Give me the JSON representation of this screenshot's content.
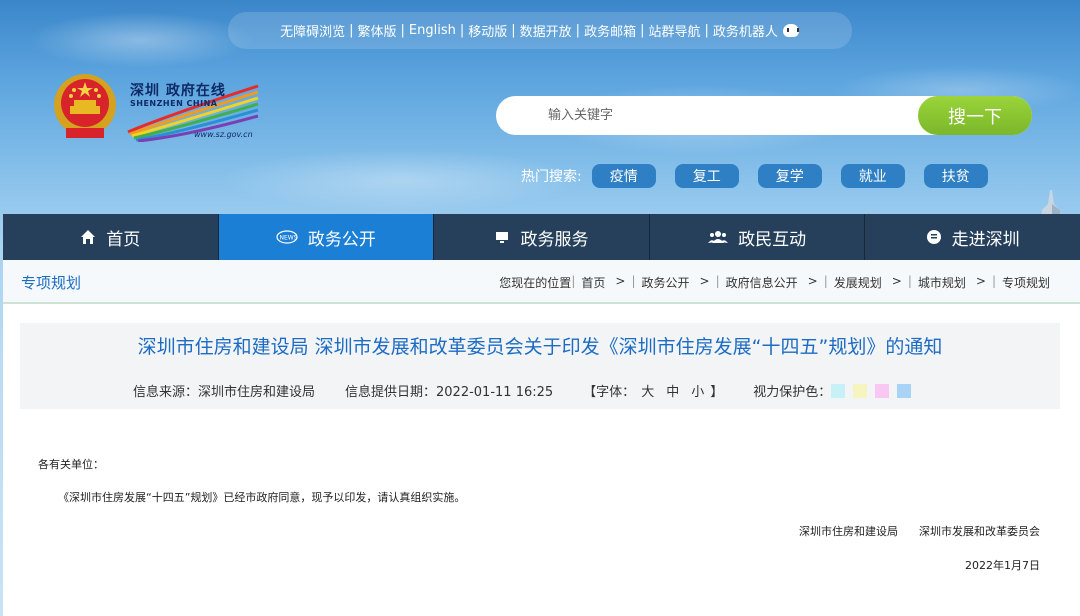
{
  "topbar": {
    "links": [
      "无障碍浏览",
      "繁体版",
      "English",
      "移动版",
      "数据开放",
      "政务邮箱",
      "站群导航",
      "政务机器人"
    ]
  },
  "logo": {
    "cn": "深圳 政府在线",
    "en": "SHENZHEN CHINA",
    "url": "www.sz.gov.cn"
  },
  "search": {
    "placeholder": "输入关键字",
    "button": "搜一下"
  },
  "hot": {
    "label": "热门搜索:",
    "tags": [
      "疫情",
      "复工",
      "复学",
      "就业",
      "扶贫"
    ]
  },
  "nav": [
    {
      "label": "首页",
      "icon": "home-icon"
    },
    {
      "label": "政务公开",
      "icon": "news-icon"
    },
    {
      "label": "政务服务",
      "icon": "monitor-icon"
    },
    {
      "label": "政民互动",
      "icon": "people-icon"
    },
    {
      "label": "走进深圳",
      "icon": "info-icon"
    }
  ],
  "breadcrumb": {
    "section": "专项规划",
    "lead": "您现在的位置",
    "items": [
      "首页",
      "政务公开",
      "政府信息公开",
      "发展规划",
      "城市规划",
      "专项规划"
    ]
  },
  "article": {
    "title": "深圳市住房和建设局 深圳市发展和改革委员会关于印发《深圳市住房发展“十四五”规划》的通知",
    "source": "信息来源：深圳市住房和建设局",
    "date": "信息提供日期：2022-01-11 16:25",
    "font_label": "【字体：",
    "font_sizes": [
      "大",
      "中",
      "小"
    ],
    "font_end": "】",
    "eye_label": "视力保护色：",
    "eye_colors": [
      "#c8f0f7",
      "#f6f5c0",
      "#f9c8f2",
      "#a9d3f5"
    ],
    "greeting": "各有关单位：",
    "content": "《深圳市住房发展“十四五”规划》已经市政府同意，现予以印发，请认真组织实施。",
    "signers": "深圳市住房和建设局      深圳市发展和改革委员会",
    "sign_date": "2022年1月7日"
  }
}
